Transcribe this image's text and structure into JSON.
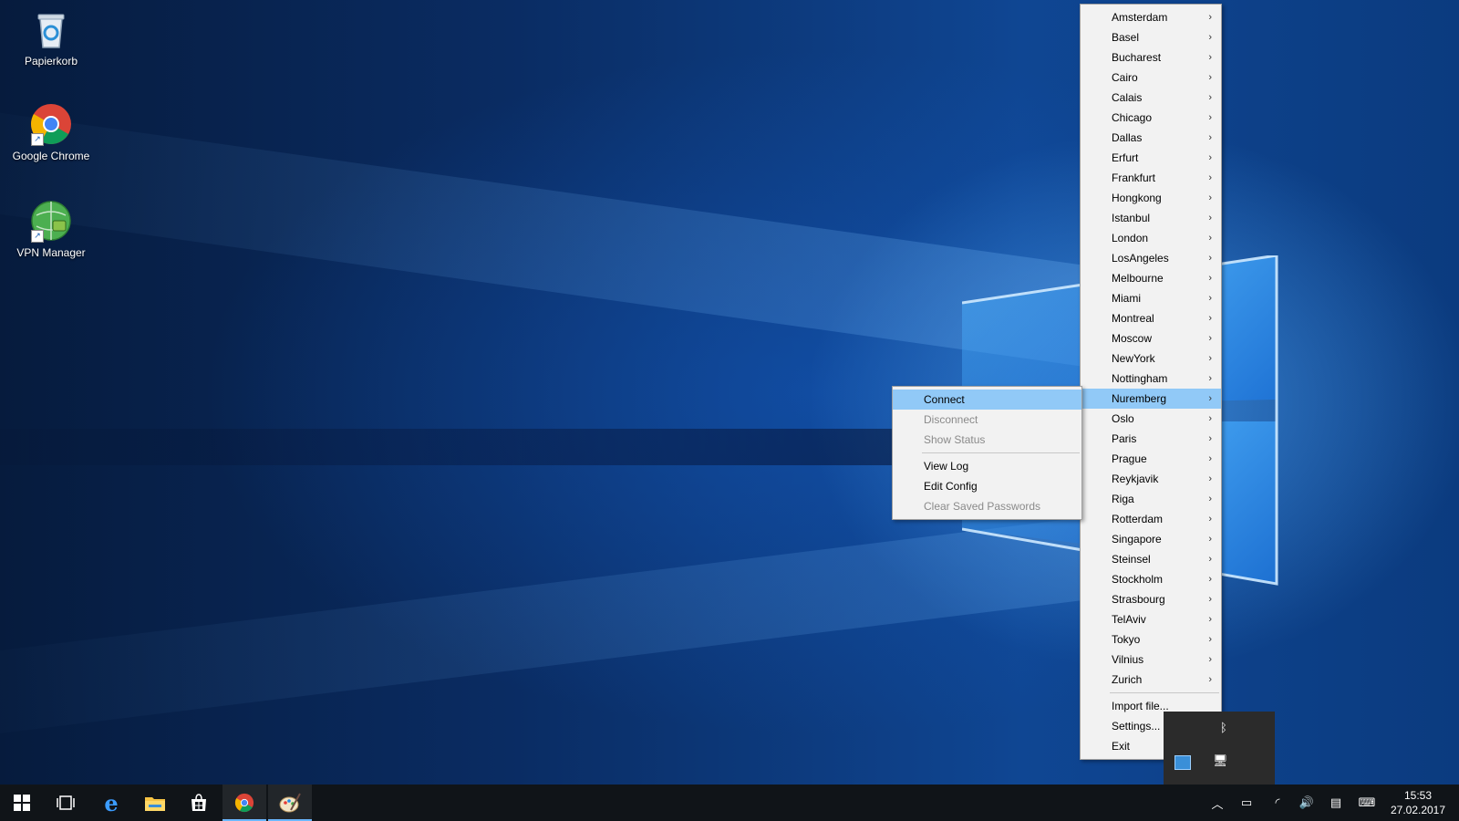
{
  "desktop": {
    "icons": [
      {
        "label": "Papierkorb",
        "icon": "recycle-bin-icon"
      },
      {
        "label": "Google Chrome",
        "icon": "chrome-icon"
      },
      {
        "label": "VPN Manager",
        "icon": "vpn-globe-icon"
      }
    ]
  },
  "server_menu": {
    "cities": [
      "Amsterdam",
      "Basel",
      "Bucharest",
      "Cairo",
      "Calais",
      "Chicago",
      "Dallas",
      "Erfurt",
      "Frankfurt",
      "Hongkong",
      "Istanbul",
      "London",
      "LosAngeles",
      "Melbourne",
      "Miami",
      "Montreal",
      "Moscow",
      "NewYork",
      "Nottingham",
      "Nuremberg",
      "Oslo",
      "Paris",
      "Prague",
      "Reykjavik",
      "Riga",
      "Rotterdam",
      "Singapore",
      "Steinsel",
      "Stockholm",
      "Strasbourg",
      "TelAviv",
      "Tokyo",
      "Vilnius",
      "Zurich"
    ],
    "highlighted": "Nuremberg",
    "footer": [
      "Import file...",
      "Settings...",
      "Exit"
    ]
  },
  "connection_menu": {
    "items": [
      {
        "label": "Connect",
        "state": "highlighted"
      },
      {
        "label": "Disconnect",
        "state": "disabled"
      },
      {
        "label": "Show Status",
        "state": "disabled"
      },
      {
        "label": "View Log",
        "state": "enabled"
      },
      {
        "label": "Edit Config",
        "state": "enabled"
      },
      {
        "label": "Clear Saved Passwords",
        "state": "disabled"
      }
    ]
  },
  "taskbar": {
    "apps": [
      "start-icon",
      "task-view-icon",
      "edge-icon",
      "file-explorer-icon",
      "store-icon",
      "chrome-icon",
      "paint-icon"
    ],
    "tray": [
      "chevron-up-icon",
      "battery-icon",
      "wifi-icon",
      "volume-icon",
      "action-center-icon",
      "keyboard-icon"
    ],
    "clock": {
      "time": "15:53",
      "date": "27.02.2017"
    }
  },
  "colors": {
    "menu_highlight": "#91c9f7",
    "taskbar": "#101418",
    "accent": "#6ab7ff"
  }
}
